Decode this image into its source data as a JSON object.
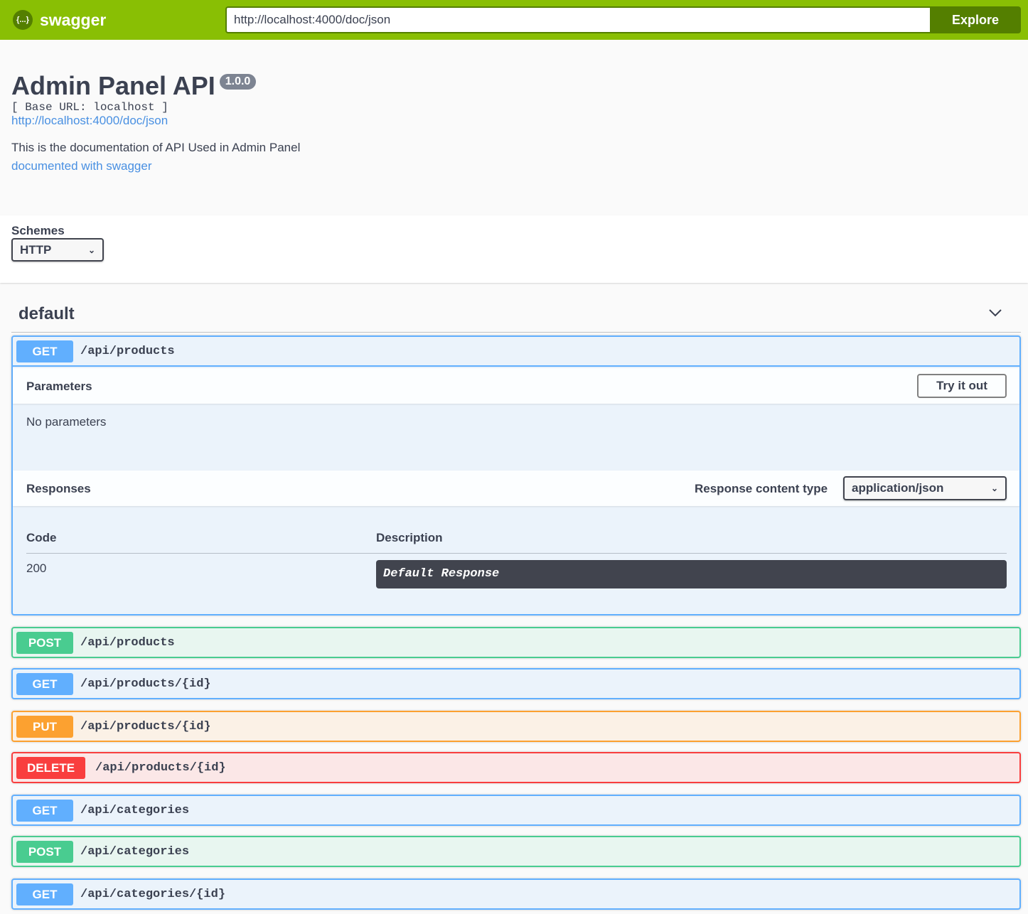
{
  "topbar": {
    "logo_text": "swagger",
    "logo_glyph": "{...}",
    "url": "http://localhost:4000/doc/json",
    "explore": "Explore"
  },
  "info": {
    "title": "Admin Panel API",
    "version": "1.0.0",
    "base_url": "[ Base URL: localhost ]",
    "spec_link": "http://localhost:4000/doc/json",
    "description": "This is the documentation of API Used in Admin Panel",
    "swagger_link": "documented with swagger"
  },
  "schemes": {
    "label": "Schemes",
    "selected": "HTTP"
  },
  "tag": {
    "name": "default"
  },
  "expanded": {
    "method": "GET",
    "path": "/api/products",
    "parameters_label": "Parameters",
    "try_label": "Try it out",
    "no_params": "No parameters",
    "responses_label": "Responses",
    "content_type_label": "Response content type",
    "content_type": "application/json",
    "code_header": "Code",
    "desc_header": "Description",
    "responses": [
      {
        "code": "200",
        "description": "Default Response"
      }
    ]
  },
  "operations": [
    {
      "method": "POST",
      "path": "/api/products"
    },
    {
      "method": "GET",
      "path": "/api/products/{id}"
    },
    {
      "method": "PUT",
      "path": "/api/products/{id}"
    },
    {
      "method": "DELETE",
      "path": "/api/products/{id}"
    },
    {
      "method": "GET",
      "path": "/api/categories"
    },
    {
      "method": "POST",
      "path": "/api/categories"
    },
    {
      "method": "GET",
      "path": "/api/categories/{id}"
    }
  ]
}
